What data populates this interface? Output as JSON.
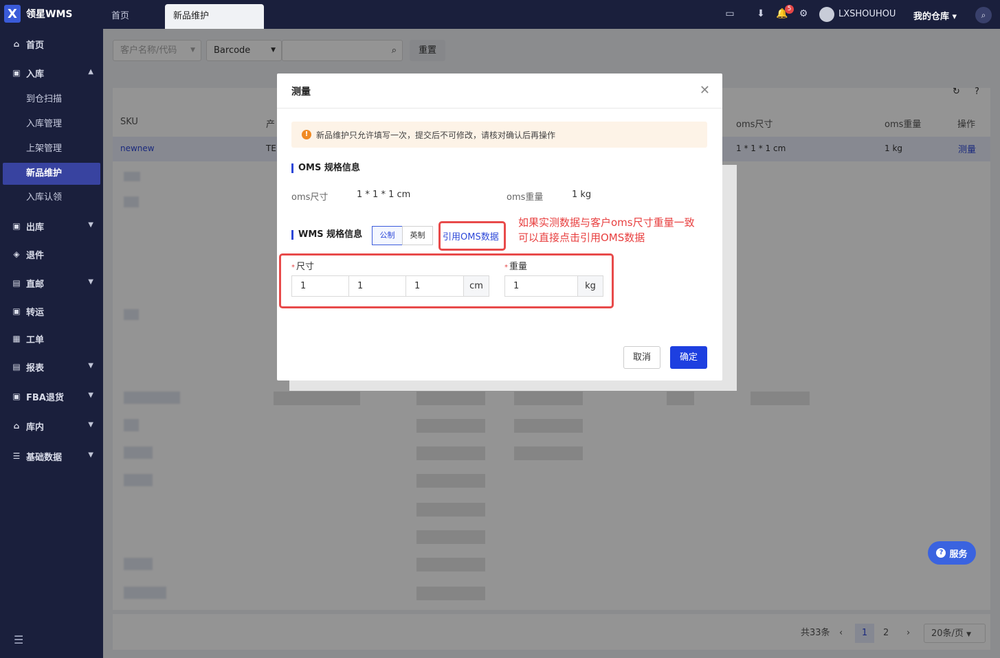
{
  "app": {
    "title": "领星WMS"
  },
  "tabs": [
    {
      "label": "首页"
    },
    {
      "label": "新品维护"
    }
  ],
  "header": {
    "bell_count": "5",
    "user": "LXSHOUHOU",
    "warehouse": "我的仓库"
  },
  "sidebar": {
    "items": [
      {
        "label": "首页"
      },
      {
        "label": "入库"
      },
      {
        "label": "到仓扫描"
      },
      {
        "label": "入库管理"
      },
      {
        "label": "上架管理"
      },
      {
        "label": "新品维护"
      },
      {
        "label": "入库认领"
      },
      {
        "label": "出库"
      },
      {
        "label": "退件"
      },
      {
        "label": "直邮"
      },
      {
        "label": "转运"
      },
      {
        "label": "工单"
      },
      {
        "label": "报表"
      },
      {
        "label": "FBA退货"
      },
      {
        "label": "库内"
      },
      {
        "label": "基础数据"
      }
    ]
  },
  "filters": {
    "customer_placeholder": "客户名称/代码",
    "barcode_select": "Barcode",
    "reset_label": "重置"
  },
  "table": {
    "headers": [
      "SKU",
      "产",
      "oms尺寸",
      "oms重量",
      "操作"
    ],
    "first_row": {
      "sku": "newnew",
      "product": "TE",
      "oms_size": "1 * 1 * 1 cm",
      "oms_weight": "1 kg",
      "action": "测量"
    }
  },
  "pagination": {
    "total": "共33条",
    "pages": [
      "1",
      "2"
    ],
    "page_size": "20条/页"
  },
  "service_button": "服务",
  "dialog": {
    "title": "测量",
    "alert": "新品维护只允许填写一次，提交后不可修改，请核对确认后再操作",
    "oms_section": "OMS 规格信息",
    "oms_size_label": "oms尺寸",
    "oms_size_value": "1 * 1 * 1 cm",
    "oms_weight_label": "oms重量",
    "oms_weight_value": "1 kg",
    "wms_section": "WMS 规格信息",
    "unit_metric": "公制",
    "unit_imperial": "英制",
    "quote_oms": "引用OMS数据",
    "size_label": "尺寸",
    "weight_label": "重量",
    "size_values": [
      "1",
      "1",
      "1"
    ],
    "size_unit": "cm",
    "weight_value": "1",
    "weight_unit": "kg",
    "cancel": "取消",
    "confirm": "确定"
  },
  "annotation": {
    "line1": "如果实测数据与客户oms尺寸重量一致",
    "line2": "可以直接点击引用OMS数据"
  },
  "colors": {
    "sidebar_bg": "#1a1f3c",
    "primary": "#1d3fe0",
    "annotation_red": "#e84a4a"
  }
}
